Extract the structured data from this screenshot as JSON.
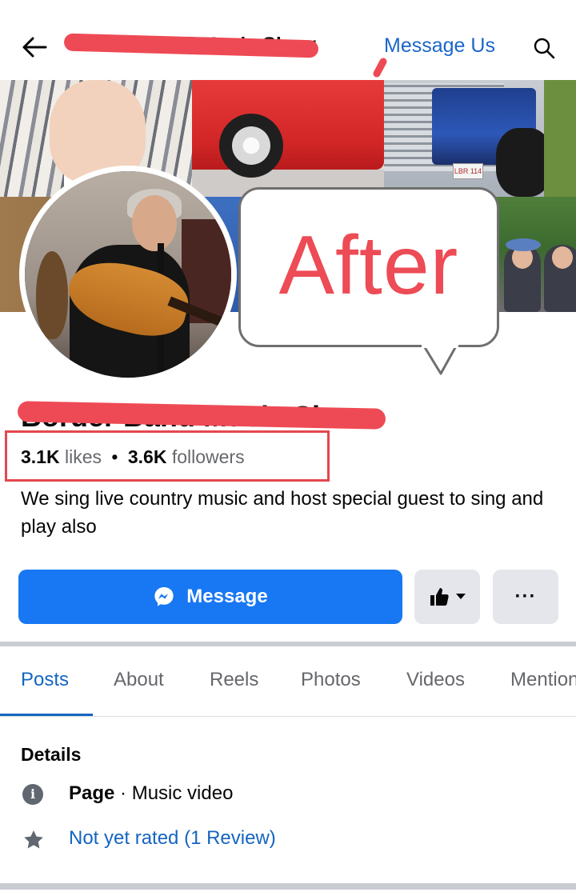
{
  "header": {
    "page_title": "Border Band Music Show",
    "message_us_label": "Message Us"
  },
  "cover": {
    "truck_plate": "LBR 114"
  },
  "annotation": {
    "bubble_text": "After",
    "colors": {
      "annotation_red": "#ed4b55"
    }
  },
  "profile": {
    "page_name": "Border Band Music Show",
    "likes_count": "3.1K",
    "likes_label": "likes",
    "separator": "•",
    "followers_count": "3.6K",
    "followers_label": "followers",
    "description": "We sing live country music and host special guest to sing and play also"
  },
  "actions": {
    "message_label": "Message",
    "more_label": "···",
    "colors": {
      "primary": "#1877f2",
      "secondary": "#e4e6eb"
    }
  },
  "tabs": [
    {
      "label": "Posts",
      "active": true
    },
    {
      "label": "About"
    },
    {
      "label": "Reels"
    },
    {
      "label": "Photos"
    },
    {
      "label": "Videos"
    },
    {
      "label": "Mentions"
    }
  ],
  "details": {
    "title": "Details",
    "page_type_label": "Page",
    "page_type_value": " · Music video",
    "rating_text": "Not yet rated (1 Review)",
    "icons": [
      "info-icon",
      "star-icon"
    ]
  }
}
